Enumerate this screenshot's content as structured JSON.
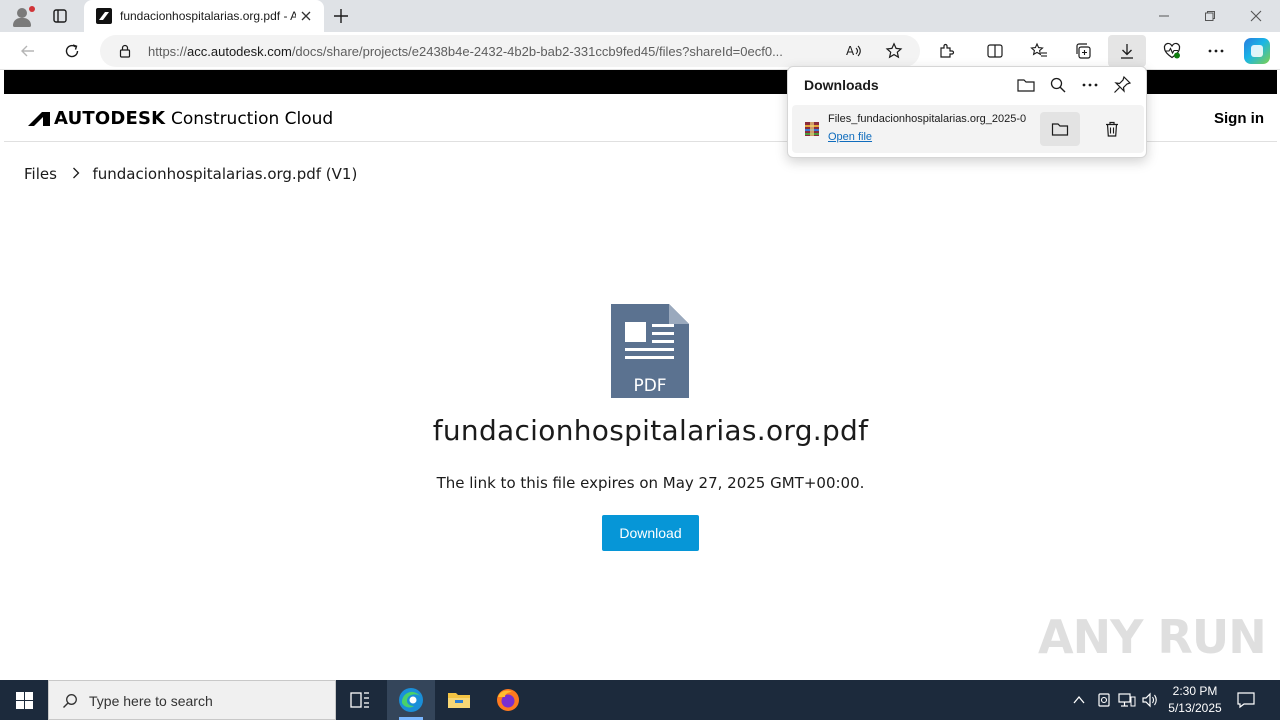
{
  "browser": {
    "tab": {
      "title": "fundacionhospitalarias.org.pdf - Autodesk Construction Cloud"
    },
    "address": {
      "url_prefix": "https://",
      "url_host": "acc.autodesk.com",
      "url_rest": "/docs/share/projects/e2438b4e-2432-4b2b-bab2-331ccb9fed45/files?shareId=0ecf0..."
    }
  },
  "downloads": {
    "title": "Downloads",
    "item": {
      "file_name": "Files_fundacionhospitalarias.org_2025-0",
      "open_label": "Open file"
    }
  },
  "page": {
    "brand": "AUTODESK",
    "product": "Construction Cloud",
    "signin": "Sign in",
    "breadcrumb": {
      "root": "Files",
      "current": "fundacionhospitalarias.org.pdf (V1)"
    },
    "file_type_label": "PDF",
    "file_name": "fundacionhospitalarias.org.pdf",
    "expiry_text": "The link to this file expires on May 27, 2025 GMT+00:00.",
    "download_label": "Download",
    "watermark": "ANY RUN"
  },
  "taskbar": {
    "search_placeholder": "Type here to search",
    "time": "2:30 PM",
    "date": "5/13/2025"
  },
  "colors": {
    "accent": "#0696d7",
    "pdf_icon": "#5b7290",
    "taskbar": "#1c2a3c"
  }
}
